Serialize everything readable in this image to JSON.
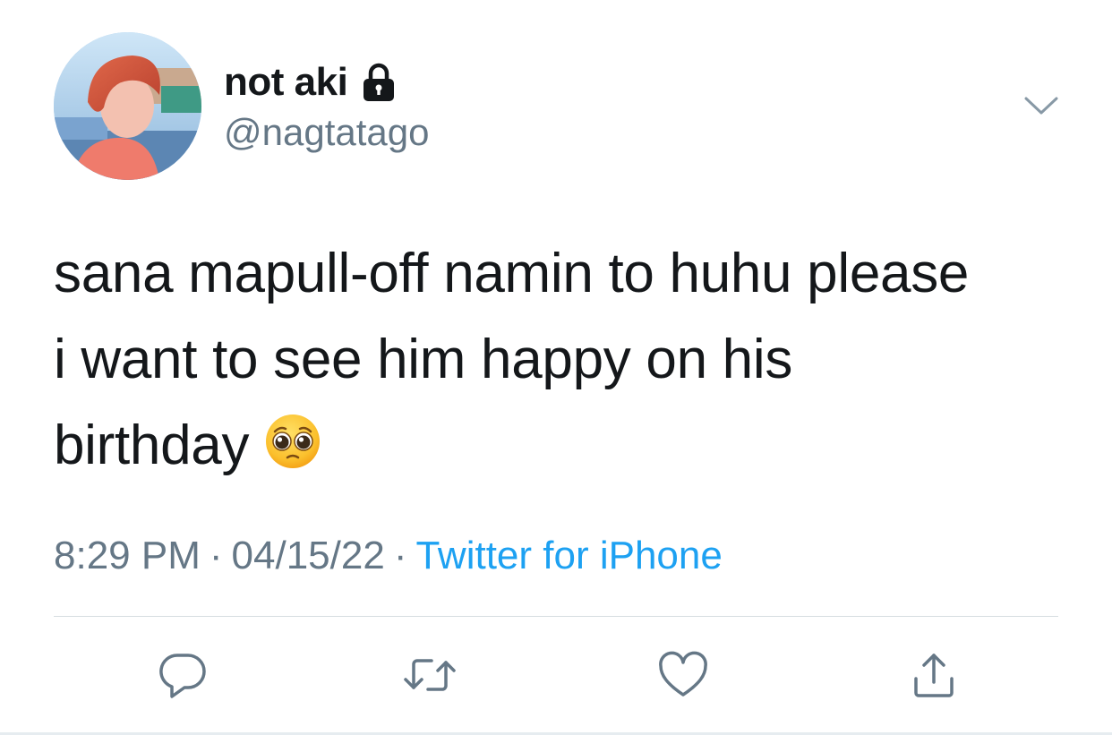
{
  "user": {
    "display_name": "not aki",
    "handle": "@nagtatago",
    "protected_icon": "lock-icon"
  },
  "tweet": {
    "lines": [
      "sana mapull-off namin to huhu please",
      "i want to see him happy on his",
      "birthday"
    ],
    "emoji": "pleading-face-emoji"
  },
  "meta": {
    "time": "8:29 PM",
    "date": "04/15/22",
    "separator": "·",
    "source": "Twitter for iPhone"
  },
  "actions": {
    "reply_icon": "reply-icon",
    "retweet_icon": "retweet-icon",
    "like_icon": "heart-icon",
    "share_icon": "share-icon"
  },
  "colors": {
    "text_primary": "#14171a",
    "text_secondary": "#657786",
    "link": "#1da1f2",
    "divider": "#d7dde1"
  }
}
